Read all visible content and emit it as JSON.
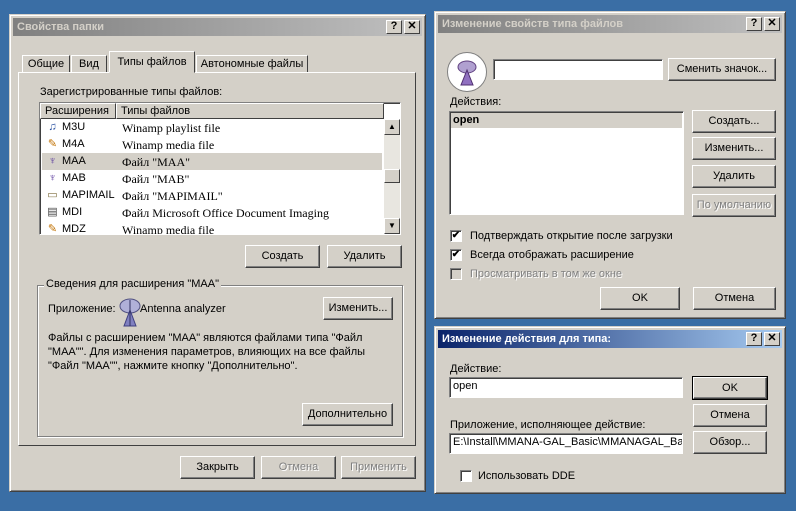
{
  "folder": {
    "title": "Свойства папки",
    "help": "?",
    "close": "✕",
    "tabs": [
      "Общие",
      "Вид",
      "Типы файлов",
      "Автономные файлы"
    ],
    "registered_label": "Зарегистрированные типы файлов:",
    "columns": [
      "Расширения",
      "Типы файлов"
    ],
    "rows": [
      {
        "ext": "M3U",
        "type": "Winamp playlist file",
        "icon": "♫"
      },
      {
        "ext": "M4A",
        "type": "Winamp media file",
        "icon": "✎"
      },
      {
        "ext": "MAA",
        "type": "Файл \"MAA\"",
        "icon": "♆"
      },
      {
        "ext": "MAB",
        "type": "Файл \"MAB\"",
        "icon": "♆"
      },
      {
        "ext": "MAPIMAIL",
        "type": "Файл \"MAPIMAIL\"",
        "icon": "▭"
      },
      {
        "ext": "MDI",
        "type": "Файл Microsoft Office Document Imaging",
        "icon": "▤"
      },
      {
        "ext": "MDZ",
        "type": "Winamp media file",
        "icon": "✎"
      }
    ],
    "create_btn": "Создать",
    "delete_btn": "Удалить",
    "details_title": "Сведения для расширения \"MAA\"",
    "app_label": "Приложение:",
    "app_name": "Antenna analyzer",
    "change_btn": "Изменить...",
    "desc1": "Файлы с расширением \"MAA\" являются файлами типа \"Файл",
    "desc2": "\"MAA\"\". Для изменения параметров, влияющих на все файлы",
    "desc3": "\"Файл \"MAA\"\", нажмите кнопку \"Дополнительно\".",
    "advanced_btn": "Дополнительно",
    "close_btn": "Закрыть",
    "cancel_btn": "Отмена",
    "apply_btn": "Применить"
  },
  "edit_type": {
    "title": "Изменение свойств типа файлов",
    "help": "?",
    "close": "✕",
    "name_value": "",
    "change_icon_btn": "Сменить значок...",
    "actions_label": "Действия:",
    "actions": [
      "open"
    ],
    "create_btn": "Создать...",
    "edit_btn": "Изменить...",
    "delete_btn": "Удалить",
    "default_btn": "По умолчанию",
    "chk1": "Подтверждать открытие после загрузки",
    "chk2": "Всегда отображать расширение",
    "chk3": "Просматривать в том же окне",
    "ok_btn": "OK",
    "cancel_btn": "Отмена"
  },
  "edit_action": {
    "title": "Изменение действия для типа:",
    "help": "?",
    "close": "✕",
    "action_label": "Действие:",
    "action_value": "open",
    "app_label": "Приложение, исполняющее действие:",
    "app_value": "E:\\Install\\MMANA-GAL_Basic\\MMANAGAL_Basi",
    "ok_btn": "OK",
    "cancel_btn": "Отмена",
    "browse_btn": "Обзор...",
    "dde_label": "Использовать DDE"
  }
}
